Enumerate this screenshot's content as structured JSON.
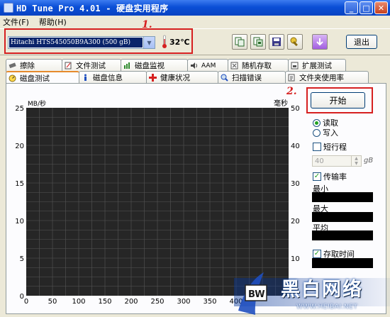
{
  "window": {
    "title": "HD Tune Pro 4.01 - 硬盘实用程序"
  },
  "menu": {
    "items": [
      "文件(F)",
      "帮助(H)"
    ]
  },
  "toolbar": {
    "drive_value": "Hitachi HTS545050B9A300 (500 gB)",
    "temperature": "32℃",
    "exit_label": "退出",
    "annotation_1": "1.",
    "annotation_2": "2."
  },
  "tabs_row1": [
    {
      "label": "擦除",
      "icon": "eraser-icon"
    },
    {
      "label": "文件测试",
      "icon": "file-test-icon"
    },
    {
      "label": "磁盘监视",
      "icon": "monitor-icon"
    },
    {
      "label": "AAM",
      "icon": "speaker-icon"
    },
    {
      "label": "随机存取",
      "icon": "random-access-icon"
    },
    {
      "label": "扩展测试",
      "icon": "extra-tests-icon"
    }
  ],
  "tabs_row2": [
    {
      "label": "磁盘测试",
      "icon": "benchmark-icon",
      "active": true
    },
    {
      "label": "磁盘信息",
      "icon": "info-icon"
    },
    {
      "label": "健康状况",
      "icon": "health-icon"
    },
    {
      "label": "扫描错误",
      "icon": "scan-icon"
    },
    {
      "label": "文件夹使用率",
      "icon": "folder-usage-icon"
    }
  ],
  "controls": {
    "start_label": "开始",
    "read_label": "读取",
    "write_label": "写入",
    "short_stroke_label": "短行程",
    "short_stroke_value": "40",
    "short_stroke_unit": "gB",
    "transfer_rate_label": "传输率",
    "min_label": "最小",
    "max_label": "最大",
    "avg_label": "平均",
    "access_time_label": "存取时间"
  },
  "chart_data": {
    "type": "line",
    "left_axis_unit": "MB/秒",
    "right_axis_unit": "毫秒",
    "left_ticks": [
      "25",
      "20",
      "15",
      "10",
      "5",
      "0"
    ],
    "right_ticks": [
      "50",
      "40",
      "30",
      "20",
      "10"
    ],
    "x_ticks": [
      "0",
      "50",
      "100",
      "150",
      "200",
      "250",
      "300",
      "350",
      "400"
    ],
    "ylim_left": [
      0,
      25
    ],
    "ylim_right": [
      0,
      50
    ],
    "xlim": [
      0,
      500
    ],
    "grid": true,
    "series": []
  },
  "watermark": {
    "text": "黑白网络",
    "url": "WWW.HEIBAI.NET",
    "logo": "HEIBAI"
  },
  "colors": {
    "annotation": "#d62020",
    "plot_bg": "#262626",
    "grid": "#555555"
  }
}
